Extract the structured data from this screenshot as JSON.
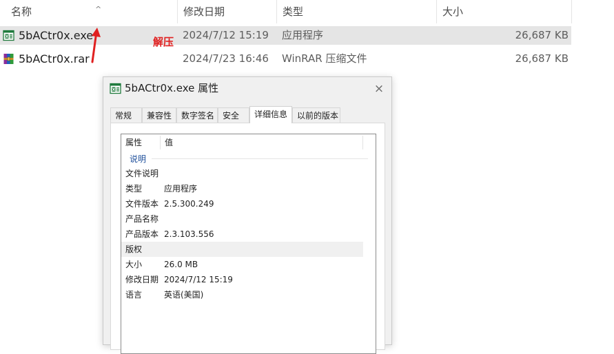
{
  "columns": {
    "name": "名称",
    "modified": "修改日期",
    "type": "类型",
    "size": "大小"
  },
  "sort_indicator": "^",
  "files": [
    {
      "name": "5bACtr0x.exe",
      "date": "2024/7/12 15:19",
      "type": "应用程序",
      "size": "26,687 KB",
      "icon": "exe-icon",
      "selected": true
    },
    {
      "name": "5bACtr0x.rar",
      "date": "2024/7/23 16:46",
      "type": "WinRAR 压缩文件",
      "size": "26,687 KB",
      "icon": "winrar-icon",
      "selected": false
    }
  ],
  "annotation": {
    "text": "解压",
    "color": "#e02020"
  },
  "dialog": {
    "title": "5bACtr0x.exe 属性",
    "close_icon": "×",
    "tabs": [
      {
        "label": "常规",
        "active": false
      },
      {
        "label": "兼容性",
        "active": false
      },
      {
        "label": "数字签名",
        "active": false
      },
      {
        "label": "安全",
        "active": false
      },
      {
        "label": "详细信息",
        "active": true
      },
      {
        "label": "以前的版本",
        "active": false
      }
    ],
    "list_header": {
      "property": "属性",
      "value": "值"
    },
    "group": "说明",
    "properties": [
      {
        "name": "文件说明",
        "value": ""
      },
      {
        "name": "类型",
        "value": "应用程序"
      },
      {
        "name": "文件版本",
        "value": "2.5.300.249"
      },
      {
        "name": "产品名称",
        "value": ""
      },
      {
        "name": "产品版本",
        "value": "2.3.103.556"
      },
      {
        "name": "版权",
        "value": ""
      },
      {
        "name": "大小",
        "value": "26.0 MB"
      },
      {
        "name": "修改日期",
        "value": "2024/7/12 15:19"
      },
      {
        "name": "语言",
        "value": "英语(美国)"
      }
    ]
  },
  "colors": {
    "selection": "#e5e5e5",
    "group_label": "#1d4e9a",
    "annotation_red": "#e02020"
  }
}
